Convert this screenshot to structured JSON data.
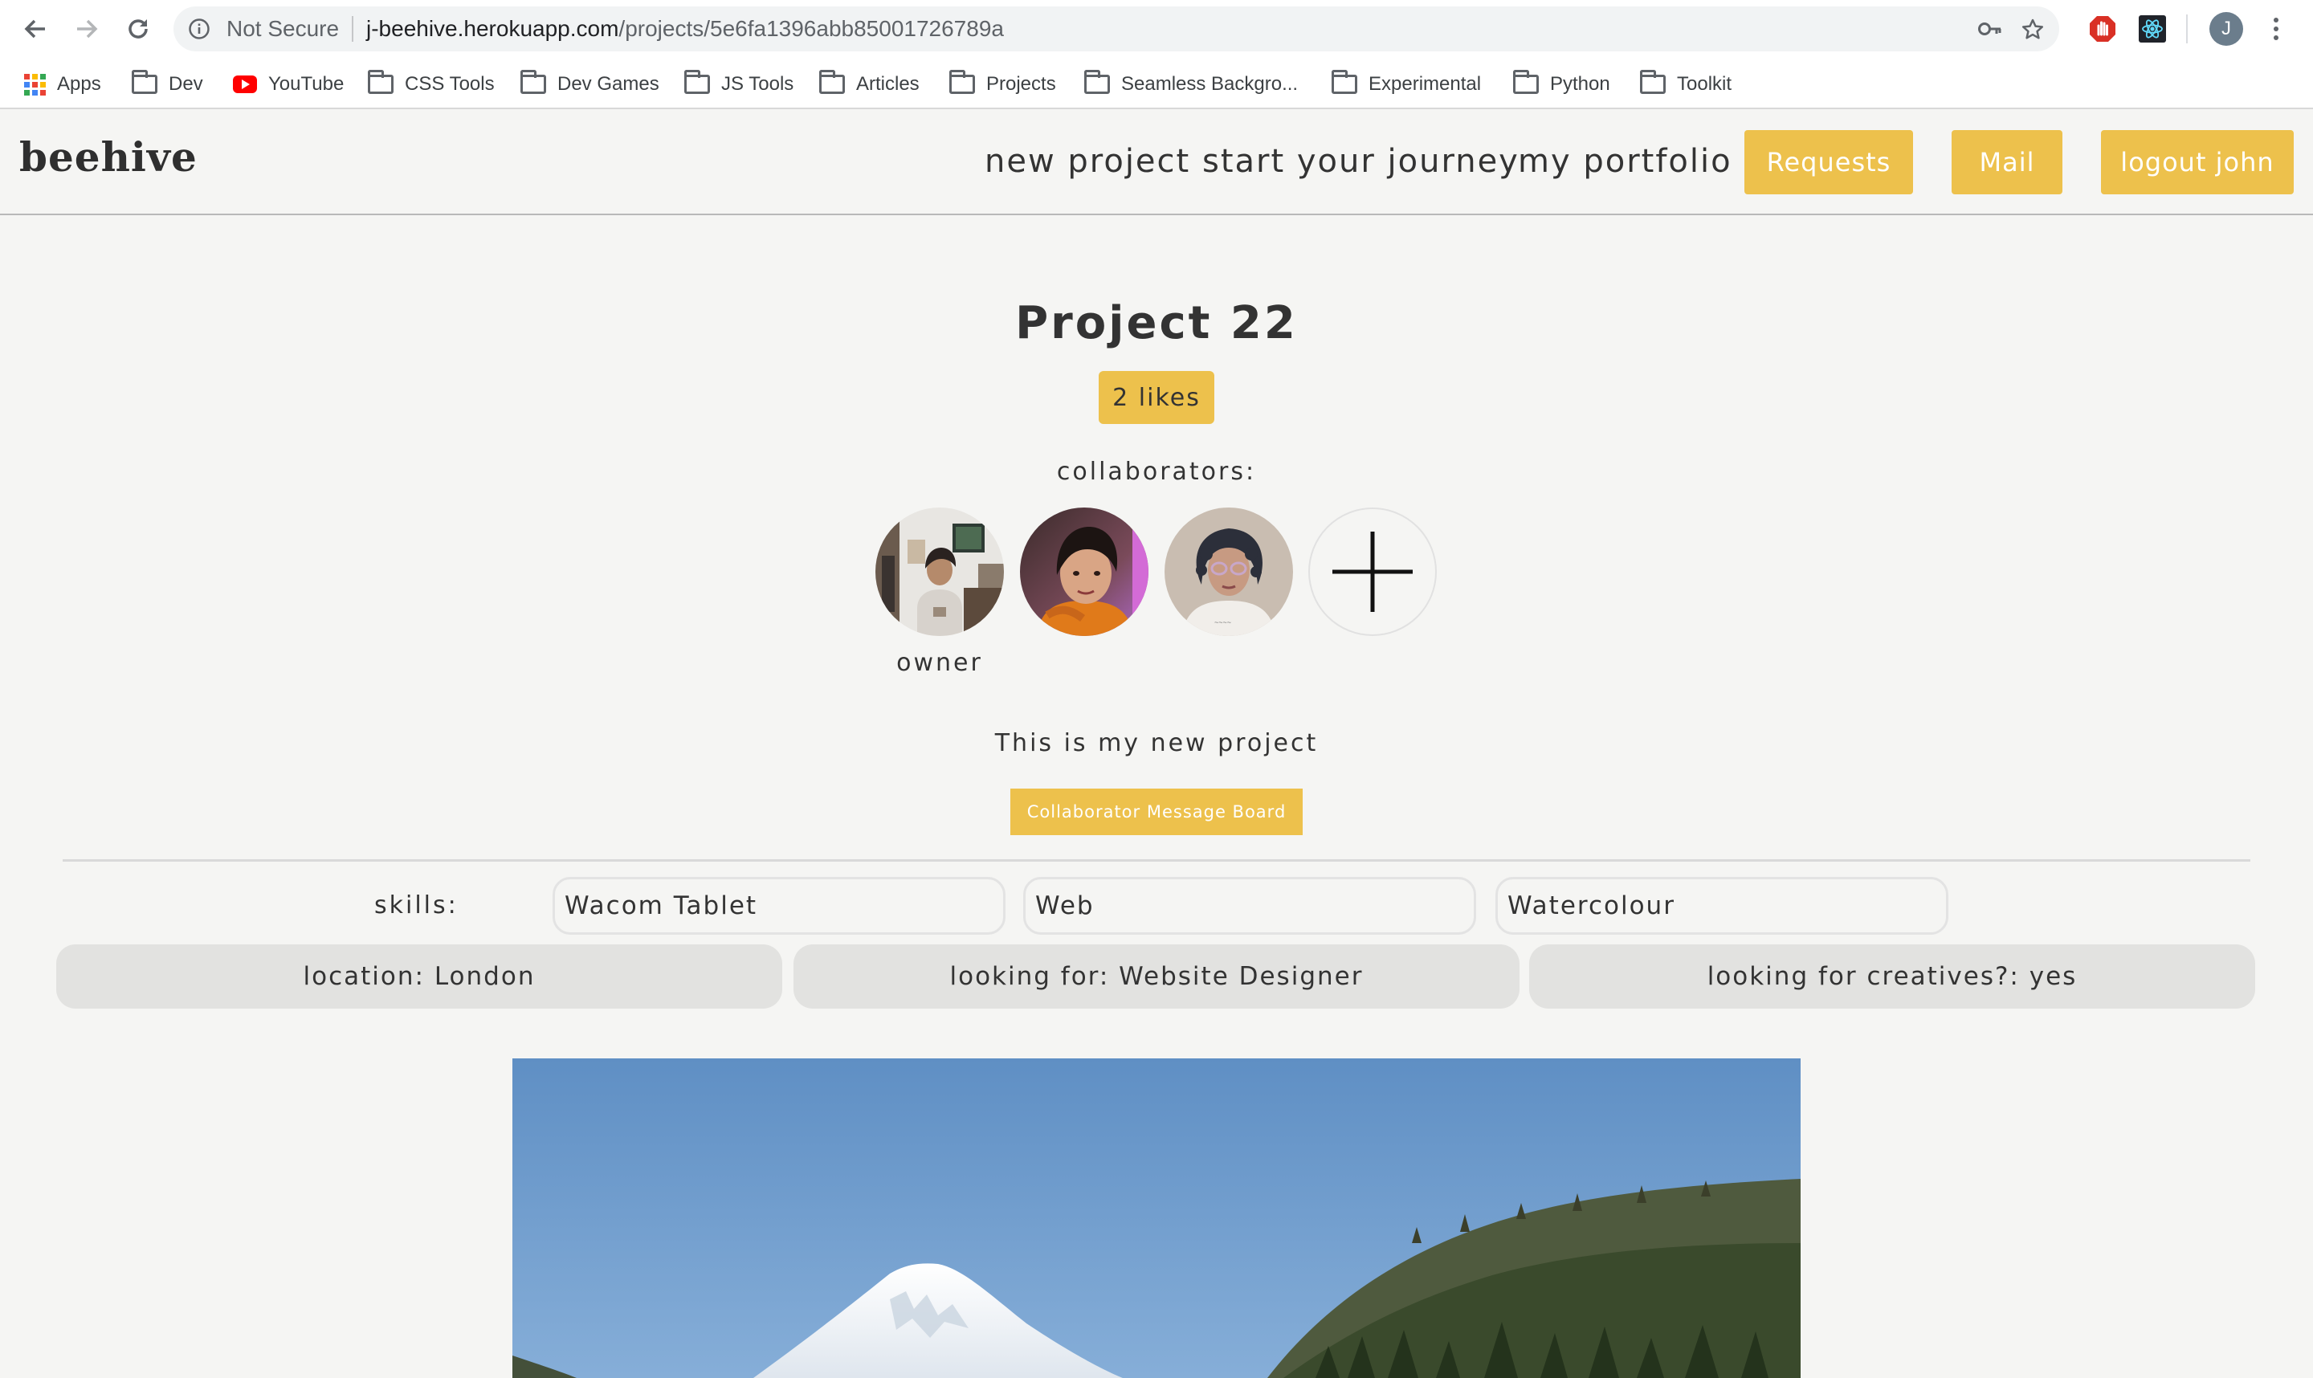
{
  "browser": {
    "security_label": "Not Secure",
    "url_host": "j-beehive.herokuapp.com",
    "url_path": "/projects/5e6fa1396abb85001726789a",
    "profile_initial": "J",
    "bookmarks": [
      "Apps",
      "Dev",
      "YouTube",
      "CSS Tools",
      "Dev Games",
      "JS Tools",
      "Articles",
      "Projects",
      "Seamless Backgro...",
      "Experimental",
      "Python",
      "Toolkit"
    ]
  },
  "header": {
    "logo": "beehive",
    "nav": [
      "new project",
      "start your journey",
      "my portfolio"
    ],
    "buttons": [
      "Requests",
      "Mail",
      "logout john"
    ],
    "accent_color": "#edc14c"
  },
  "project": {
    "title": "Project 22",
    "likes": "2 likes",
    "collaborators_label": "collaborators:",
    "owner_label": "owner",
    "description": "This is my new project",
    "message_board_label": "Collaborator Message Board",
    "skills_label": "skills:",
    "skills": [
      "Wacom Tablet",
      "Web",
      "Watercolour"
    ],
    "location": "location: London",
    "looking_for": "looking for: Website Designer",
    "looking_for_creatives": "looking for creatives?: yes"
  }
}
